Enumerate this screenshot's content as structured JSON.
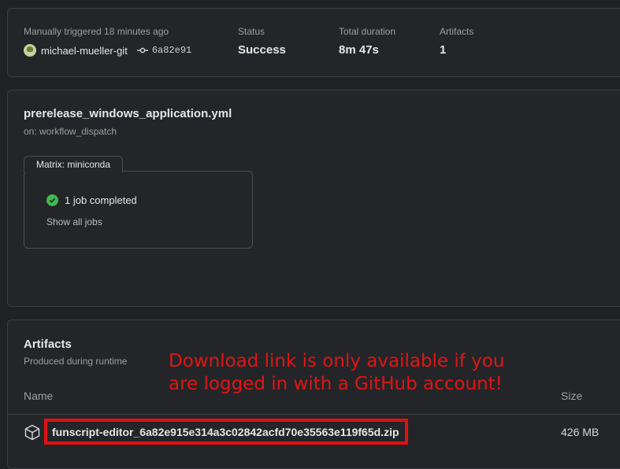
{
  "summary": {
    "trigger_label": "Manually triggered 18 minutes ago",
    "user": "michael-mueller-git",
    "commit": "6a82e91",
    "status_label": "Status",
    "status_value": "Success",
    "duration_label": "Total duration",
    "duration_value": "8m 47s",
    "artifacts_label": "Artifacts",
    "artifacts_value": "1"
  },
  "workflow": {
    "file": "prerelease_windows_application.yml",
    "trigger": "on: workflow_dispatch",
    "matrix_label": "Matrix: miniconda",
    "jobs_completed": "1 job completed",
    "show_all": "Show all jobs"
  },
  "artifacts": {
    "title": "Artifacts",
    "subtitle": "Produced during runtime",
    "col_name": "Name",
    "col_size": "Size",
    "item_name": "funscript-editor_6a82e915e314a3c02842acfd70e35563e119f65d.zip",
    "item_size": "426 MB",
    "annotation_line1": "Download link is only available if you",
    "annotation_line2": "are logged in with a GitHub account!"
  },
  "colors": {
    "success": "#3fb950",
    "annotation": "#e01515"
  }
}
